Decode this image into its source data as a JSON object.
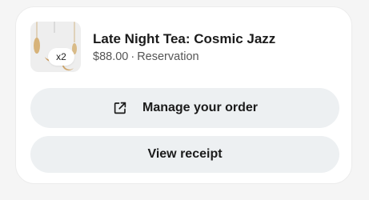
{
  "order": {
    "quantity_badge": "x2",
    "title": "Late Night Tea: Cosmic Jazz",
    "price": "$88.00",
    "separator": "·",
    "type": "Reservation"
  },
  "actions": {
    "manage_label": "Manage your order",
    "manage_icon": "external-link-icon",
    "receipt_label": "View receipt"
  },
  "colors": {
    "button_bg": "#edf0f2",
    "text_primary": "#1b1b1b",
    "text_secondary": "#555555"
  }
}
